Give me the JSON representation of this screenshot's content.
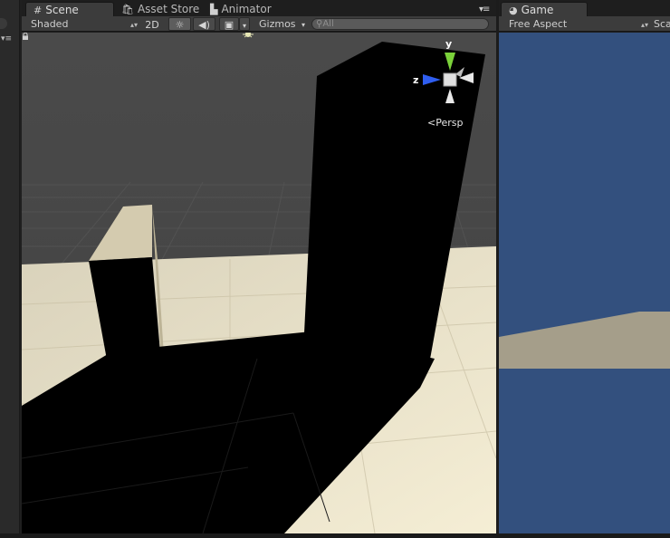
{
  "scene_panel": {
    "tabs": [
      {
        "label": "Scene",
        "icon": "grid-icon"
      },
      {
        "label": "Asset Store",
        "icon": "shopping-bag-icon"
      },
      {
        "label": "Animator",
        "icon": "animator-icon"
      }
    ],
    "toolbar": {
      "render_mode": "Shaded",
      "mode_2d": "2D",
      "gizmos": "Gizmos",
      "search_placeholder": "All"
    },
    "orientation_gizmo": {
      "y_label": "y",
      "z_label": "z",
      "projection": "Persp"
    }
  },
  "game_panel": {
    "tab": {
      "label": "Game",
      "icon": "pacman-icon"
    },
    "toolbar": {
      "aspect": "Free Aspect",
      "scale_truncated": "Sca"
    }
  },
  "colors": {
    "editor_bg": "#3c3c3c",
    "game_sky": "#33507e",
    "game_ground": "#a59e8a",
    "floor": "#e5dcc0",
    "shadow": "#000000",
    "gizmo_y": "#7bd23a",
    "gizmo_z": "#2f5ef0"
  }
}
